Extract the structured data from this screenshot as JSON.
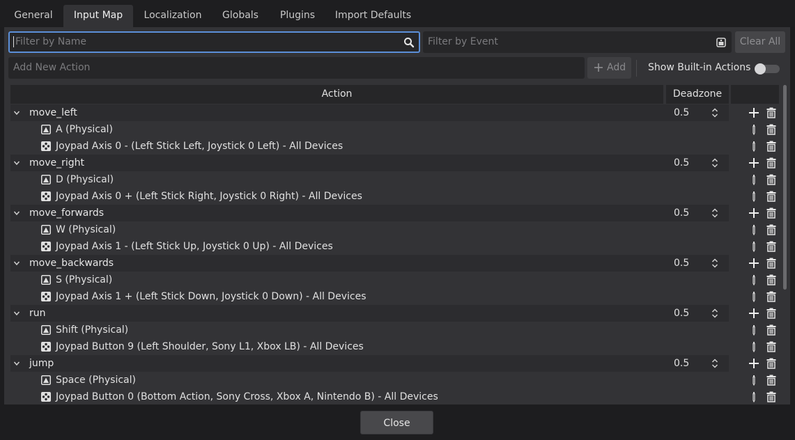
{
  "tabs": [
    "General",
    "Input Map",
    "Localization",
    "Globals",
    "Plugins",
    "Import Defaults"
  ],
  "active_tab": "Input Map",
  "filters": {
    "name_placeholder": "Filter by Name",
    "event_placeholder": "Filter by Event",
    "clear_all_label": "Clear All"
  },
  "add_action": {
    "placeholder": "Add New Action",
    "add_label": "Add"
  },
  "builtin_toggle": {
    "label": "Show Built-in Actions",
    "on": false
  },
  "columns": {
    "action": "Action",
    "deadzone": "Deadzone"
  },
  "actions": [
    {
      "name": "move_left",
      "deadzone": "0.5",
      "events": [
        {
          "type": "key",
          "label": "A (Physical)"
        },
        {
          "type": "joypad",
          "label": "Joypad Axis 0 - (Left Stick Left, Joystick 0 Left) - All Devices"
        }
      ]
    },
    {
      "name": "move_right",
      "deadzone": "0.5",
      "events": [
        {
          "type": "key",
          "label": "D (Physical)"
        },
        {
          "type": "joypad",
          "label": "Joypad Axis 0 + (Left Stick Right, Joystick 0 Right) - All Devices"
        }
      ]
    },
    {
      "name": "move_forwards",
      "deadzone": "0.5",
      "events": [
        {
          "type": "key",
          "label": "W (Physical)"
        },
        {
          "type": "joypad",
          "label": "Joypad Axis 1 - (Left Stick Up, Joystick 0 Up) - All Devices"
        }
      ]
    },
    {
      "name": "move_backwards",
      "deadzone": "0.5",
      "events": [
        {
          "type": "key",
          "label": "S (Physical)"
        },
        {
          "type": "joypad",
          "label": "Joypad Axis 1 + (Left Stick Down, Joystick 0 Down) - All Devices"
        }
      ]
    },
    {
      "name": "run",
      "deadzone": "0.5",
      "events": [
        {
          "type": "key",
          "label": "Shift (Physical)"
        },
        {
          "type": "joypad",
          "label": "Joypad Button 9 (Left Shoulder, Sony L1, Xbox LB) - All Devices"
        }
      ]
    },
    {
      "name": "jump",
      "deadzone": "0.5",
      "events": [
        {
          "type": "key",
          "label": "Space (Physical)"
        },
        {
          "type": "joypad",
          "label": "Joypad Button 0 (Bottom Action, Sony Cross, Xbox A, Nintendo B) - All Devices"
        }
      ]
    }
  ],
  "close_label": "Close",
  "colors": {
    "accent": "#5b8fd9",
    "panel": "#333336",
    "background": "#1d1d1f"
  }
}
